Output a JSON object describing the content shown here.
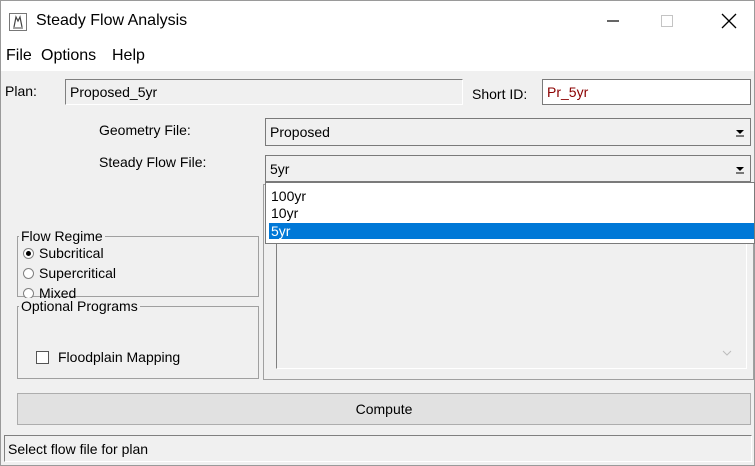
{
  "window": {
    "title": "Steady Flow Analysis",
    "icon": "hec-ras-icon",
    "controls": {
      "minimize": "minimize-icon",
      "maximize": "maximize-icon",
      "close": "close-icon"
    }
  },
  "menu": {
    "items": [
      "File",
      "Options",
      "Help"
    ]
  },
  "plan": {
    "label": "Plan:",
    "value": "Proposed_5yr",
    "short_id_label": "Short ID:",
    "short_id_value": "Pr_5yr",
    "short_id_color": "#8b0000"
  },
  "geometry": {
    "label": "Geometry File:",
    "value": "Proposed"
  },
  "flow_file": {
    "label": "Steady Flow File:",
    "value": "5yr",
    "options": [
      "100yr",
      "10yr",
      "5yr"
    ],
    "selected_index": 2
  },
  "flow_regime": {
    "title": "Flow Regime",
    "options": [
      "Subcritical",
      "Supercritical",
      "Mixed"
    ],
    "selected": "Subcritical"
  },
  "optional_programs": {
    "title": "Optional Programs",
    "floodplain_mapping_label": "Floodplain Mapping",
    "floodplain_mapping_checked": false
  },
  "compute_button": "Compute",
  "status": "Select flow file for plan",
  "colors": {
    "selection": "#0078d7",
    "window_bg": "#f0f0f0"
  }
}
